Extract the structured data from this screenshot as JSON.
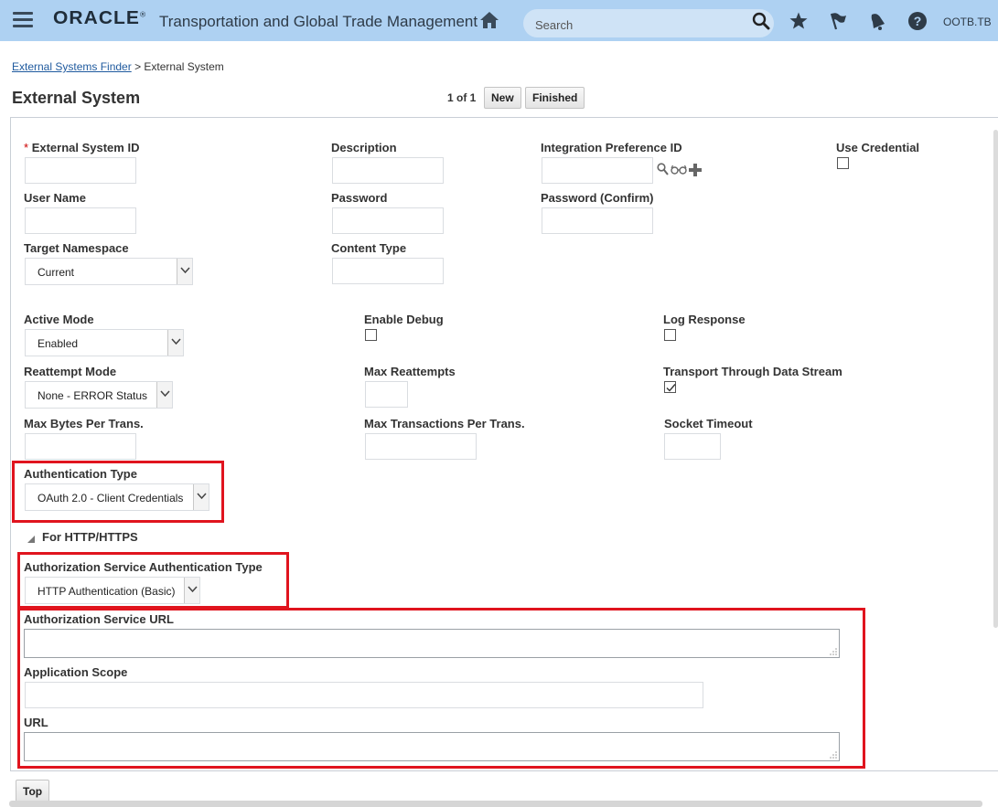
{
  "header": {
    "brand": "ORACLE",
    "brand_mark": "®",
    "app_title": "Transportation and Global Trade Management",
    "search_placeholder": "Search",
    "user": "OOTB.TB",
    "icons": [
      "menu-icon",
      "home-icon",
      "search-icon",
      "star-icon",
      "flag-icon",
      "bell-icon",
      "help-icon"
    ]
  },
  "breadcrumb": {
    "link": "External Systems Finder",
    "separator": ">",
    "current": "External System"
  },
  "page": {
    "title": "External System",
    "pager": "1 of 1",
    "new_label": "New",
    "finished_label": "Finished"
  },
  "fields": {
    "external_system_id": {
      "required_mark": "*",
      "label": "External System ID",
      "value": ""
    },
    "description": {
      "label": "Description",
      "value": ""
    },
    "integration_preference_id": {
      "label": "Integration Preference ID",
      "value": ""
    },
    "use_credential": {
      "label": "Use Credential",
      "checked": false
    },
    "user_name": {
      "label": "User Name",
      "value": ""
    },
    "password": {
      "label": "Password",
      "value": ""
    },
    "password_confirm": {
      "label": "Password (Confirm)",
      "value": ""
    },
    "target_namespace": {
      "label": "Target Namespace",
      "value": "Current"
    },
    "content_type": {
      "label": "Content Type",
      "value": ""
    },
    "active_mode": {
      "label": "Active Mode",
      "value": "Enabled"
    },
    "enable_debug": {
      "label": "Enable Debug",
      "checked": false
    },
    "log_response": {
      "label": "Log Response",
      "checked": false
    },
    "reattempt_mode": {
      "label": "Reattempt Mode",
      "value": "None - ERROR Status"
    },
    "max_reattempts": {
      "label": "Max Reattempts",
      "value": ""
    },
    "transport_through_data_stream": {
      "label": "Transport Through Data Stream",
      "checked": true
    },
    "max_bytes_per_trans": {
      "label": "Max Bytes Per Trans.",
      "value": ""
    },
    "max_transactions_per_trans": {
      "label": "Max Transactions Per Trans.",
      "value": ""
    },
    "socket_timeout": {
      "label": "Socket Timeout",
      "value": ""
    },
    "authentication_type": {
      "label": "Authentication Type",
      "value": "OAuth 2.0 - Client Credentials"
    }
  },
  "http_section": {
    "title": "For HTTP/HTTPS",
    "auth_service_auth_type": {
      "label": "Authorization Service Authentication Type",
      "value": "HTTP Authentication (Basic)"
    },
    "auth_service_url": {
      "label": "Authorization Service URL",
      "value": ""
    },
    "application_scope": {
      "label": "Application Scope",
      "value": ""
    },
    "url": {
      "label": "URL",
      "value": ""
    }
  },
  "footer": {
    "top_label": "Top"
  },
  "colors": {
    "topbar": "#aed1f2",
    "highlight": "#e0141e",
    "link": "#1f5a9e",
    "required": "#cc0000"
  }
}
